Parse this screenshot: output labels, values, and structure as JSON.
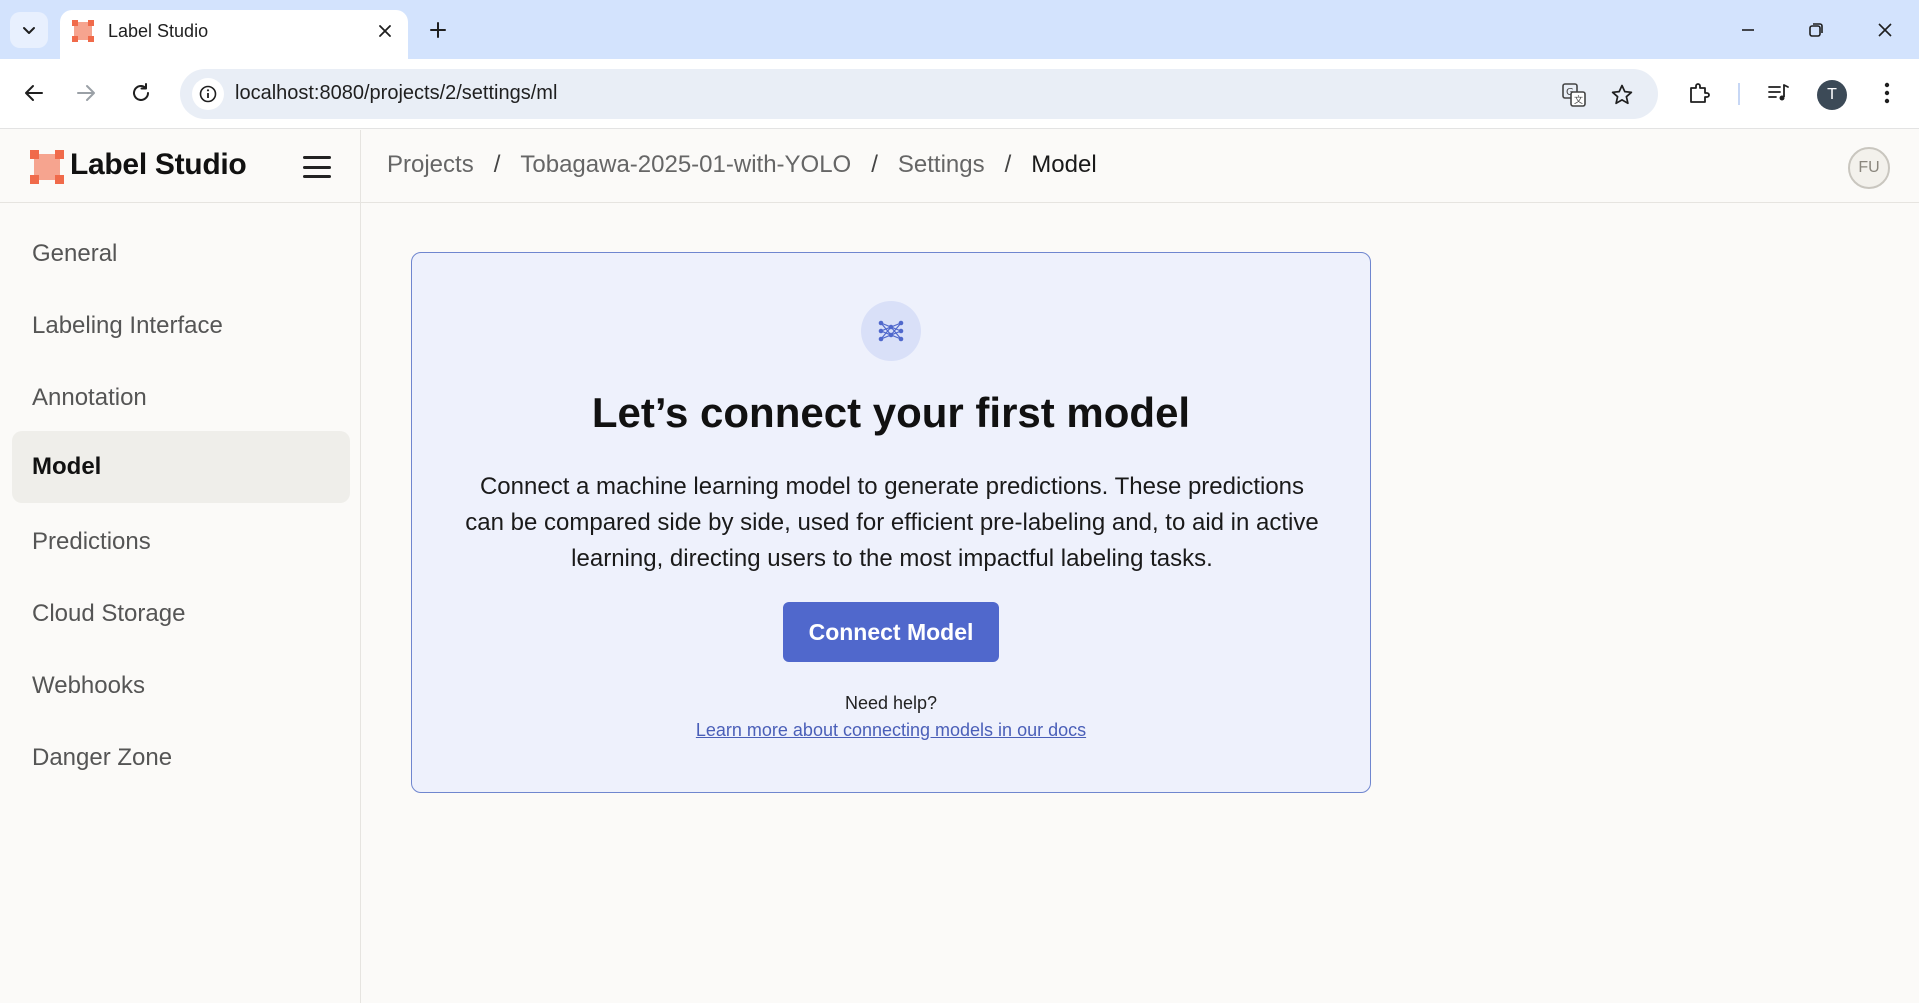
{
  "browser": {
    "tab_title": "Label Studio",
    "url": "localhost:8080/projects/2/settings/ml",
    "profile_initial": "T",
    "icons": [
      "tab-search-icon",
      "favicon-icon",
      "close-icon",
      "plus-icon",
      "minimize-icon",
      "restore-icon",
      "window-close-icon",
      "back-arrow-icon",
      "forward-arrow-icon",
      "reload-icon",
      "site-info-icon",
      "translate-icon",
      "star-icon",
      "extensions-icon",
      "media-controls-icon",
      "more-vert-icon"
    ]
  },
  "header": {
    "logo_text": "Label Studio",
    "breadcrumb": [
      "Projects",
      "Tobagawa-2025-01-with-YOLO",
      "Settings",
      "Model"
    ],
    "separator": "/",
    "user_initials": "FU"
  },
  "sidebar": {
    "items": [
      {
        "label": "General"
      },
      {
        "label": "Labeling Interface"
      },
      {
        "label": "Annotation"
      },
      {
        "label": "Model",
        "active": true
      },
      {
        "label": "Predictions"
      },
      {
        "label": "Cloud Storage"
      },
      {
        "label": "Webhooks"
      },
      {
        "label": "Danger Zone"
      }
    ]
  },
  "main": {
    "title": "Let’s connect your first model",
    "description": "Connect a machine learning model to generate predictions. These predictions can be compared side by side, used for efficient pre-labeling and, to aid in active learning, directing users to the most impactful labeling tasks.",
    "button_label": "Connect Model",
    "help_text": "Need help?",
    "help_link": "Learn more about connecting models in our docs"
  },
  "colors": {
    "accent": "#5068cc",
    "card_bg": "#eef1fc",
    "card_border": "#6f86cf",
    "logo": "#f06a4a",
    "chrome_tabbar": "#d3e3fd"
  }
}
